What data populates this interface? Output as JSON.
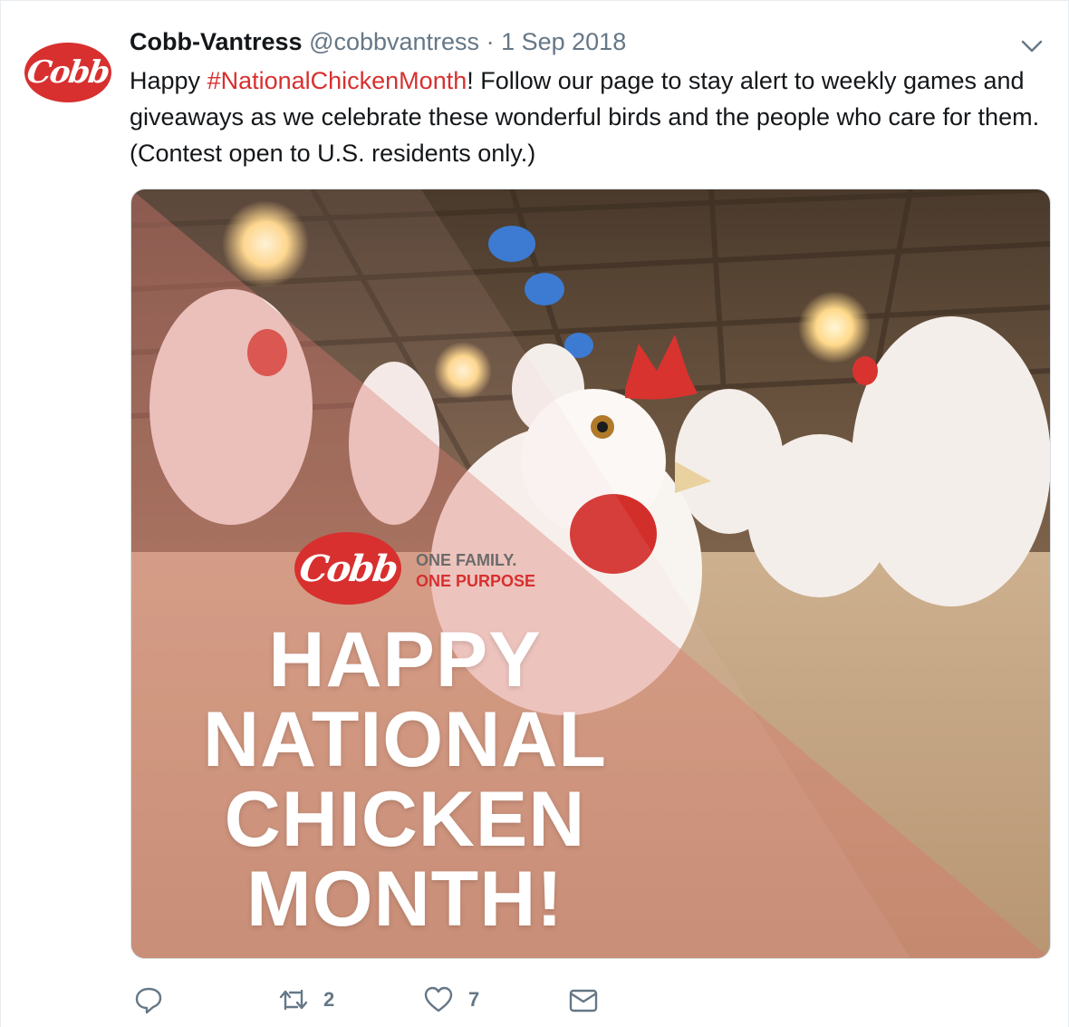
{
  "tweet": {
    "author_name": "Cobb-Vantress",
    "author_handle": "@cobbvantress",
    "separator": "·",
    "date": "1 Sep 2018",
    "avatar_text": "Cobb",
    "text_before": "Happy ",
    "hashtag": "#NationalChickenMonth",
    "text_after": "! Follow our page to stay alert to weekly games and giveaways as we celebrate these wonderful birds and the people who care for them. (Contest open to U.S. residents only.)"
  },
  "media": {
    "logo_text": "Cobb",
    "tagline_1": "ONE FAMILY.",
    "tagline_2": "ONE PURPOSE",
    "headline": [
      "HAPPY",
      "NATIONAL",
      "CHICKEN",
      "MONTH!"
    ]
  },
  "actions": {
    "reply_count": "",
    "retweet_count": "2",
    "like_count": "7"
  },
  "colors": {
    "brand_red": "#d7302f",
    "muted_text": "#657786"
  },
  "icons": [
    "chevron-down-icon",
    "reply-icon",
    "retweet-icon",
    "like-icon",
    "direct-message-icon"
  ]
}
